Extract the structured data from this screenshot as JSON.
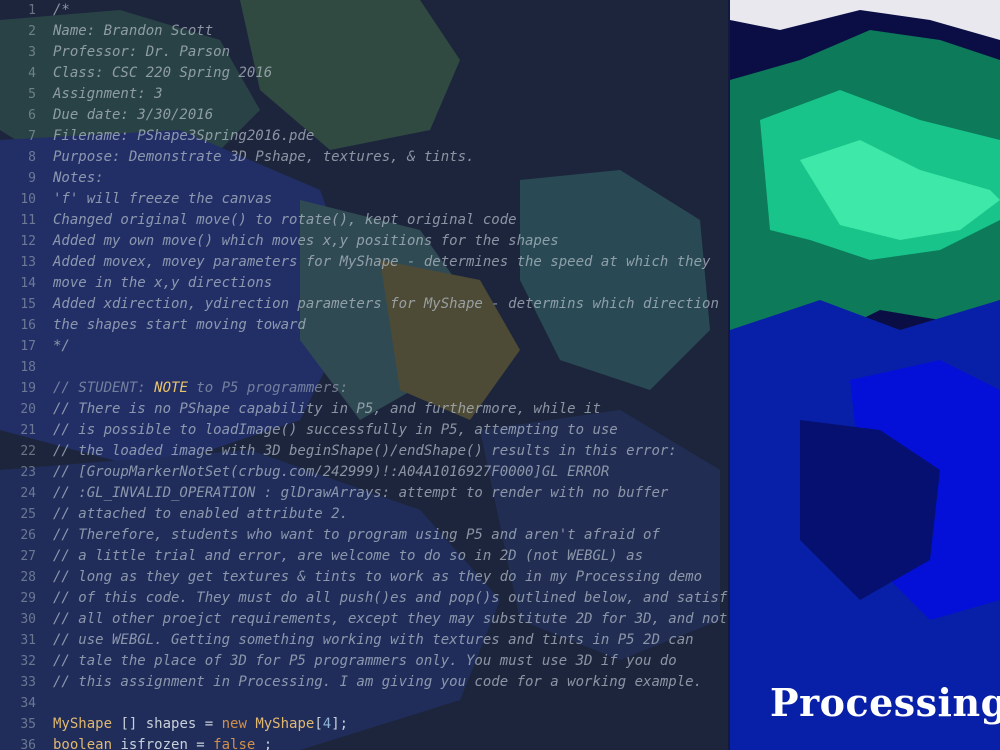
{
  "brand": {
    "logo_text": "Processing"
  },
  "editor": {
    "lines": [
      {
        "n": "1",
        "text": "/*"
      },
      {
        "n": "2",
        "text": "Name: Brandon Scott"
      },
      {
        "n": "3",
        "text": "Professor: Dr. Parson"
      },
      {
        "n": "4",
        "text": "Class: CSC 220 Spring 2016"
      },
      {
        "n": "5",
        "text": "Assignment: 3"
      },
      {
        "n": "6",
        "text": "Due date: 3/30/2016"
      },
      {
        "n": "7",
        "text": "Filename: PShape3Spring2016.pde"
      },
      {
        "n": "8",
        "text": "Purpose: Demonstrate 3D Pshape, textures, & tints."
      },
      {
        "n": "9",
        "text": "Notes:"
      },
      {
        "n": "10",
        "text": "'f' will freeze the canvas"
      },
      {
        "n": "11",
        "text": "Changed original move() to rotate(), kept original code"
      },
      {
        "n": "12",
        "text": "Added my own move() which moves x,y positions for the shapes"
      },
      {
        "n": "13",
        "text": "Added movex, movey parameters for MyShape - determines the speed at which they"
      },
      {
        "n": "14",
        "text": "move in the x,y directions"
      },
      {
        "n": "15",
        "text": "Added xdirection, ydirection parameters for MyShape - determins which direction"
      },
      {
        "n": "16",
        "text": "the shapes start moving toward"
      },
      {
        "n": "17",
        "text": "*/"
      },
      {
        "n": "18",
        "text": ""
      },
      {
        "n": "19",
        "pre": "// STUDENT: ",
        "note": "NOTE",
        "post": " to P5 programmers:"
      },
      {
        "n": "20",
        "text": "// There is no PShape capability in P5, and furthermore, while it"
      },
      {
        "n": "21",
        "text": "// is possible to loadImage() successfully in P5, attempting to use"
      },
      {
        "n": "22",
        "text": "// the loaded image with 3D beginShape()/endShape() results in this error:"
      },
      {
        "n": "23",
        "text": "// [GroupMarkerNotSet(crbug.com/242999)!:A04A1016927F0000]GL ERROR"
      },
      {
        "n": "24",
        "text": "// :GL_INVALID_OPERATION : glDrawArrays: attempt to render with no buffer"
      },
      {
        "n": "25",
        "text": "// attached to enabled attribute 2."
      },
      {
        "n": "26",
        "text": "// Therefore, students who want to program using P5 and aren't afraid of"
      },
      {
        "n": "27",
        "text": "// a little trial and error, are welcome to do so in 2D (not WEBGL) as"
      },
      {
        "n": "28",
        "text": "// long as they get textures & tints to work as they do in my Processing demo"
      },
      {
        "n": "29",
        "text": "// of this code. They must do all push()es and pop()s outlined below, and satisf"
      },
      {
        "n": "30",
        "text": "// all other proejct requirements, except they may substitute 2D for 3D, and not"
      },
      {
        "n": "31",
        "text": "// use WEBGL. Getting something working with textures and tints in P5 2D can"
      },
      {
        "n": "32",
        "text": "// tale the place of 3D for P5 programmers only. You must use 3D if you do"
      },
      {
        "n": "33",
        "text": "// this assignment in Processing. I am giving you code for a working example."
      },
      {
        "n": "34",
        "text": ""
      },
      {
        "n": "35",
        "t1": "MyShape",
        "t2": " [] shapes = ",
        "t3": "new",
        "t4": " ",
        "t5": "MyShape",
        "t6": "[",
        "t7": "4",
        "t8": "];"
      },
      {
        "n": "36",
        "u1": "boolean",
        "u2": " isfrozen = ",
        "u3": "false",
        "u4": " ;"
      }
    ]
  }
}
